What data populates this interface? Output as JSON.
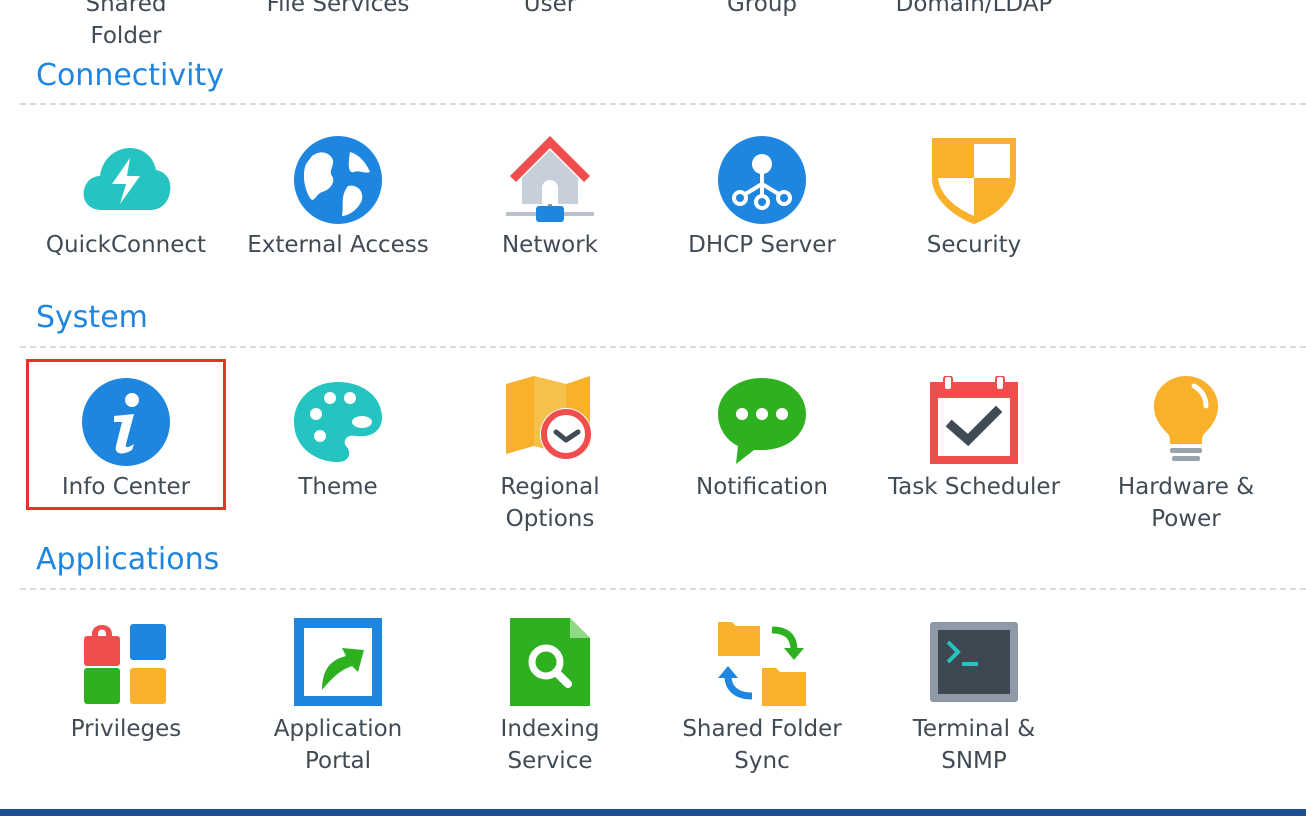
{
  "top_row": [
    {
      "name": "shared-folder",
      "label": "Shared\nFolder"
    },
    {
      "name": "file-services",
      "label": "File Services"
    },
    {
      "name": "user",
      "label": "User"
    },
    {
      "name": "group",
      "label": "Group"
    },
    {
      "name": "domain-ldap",
      "label": "Domain/LDAP"
    }
  ],
  "sections": {
    "connectivity": {
      "title": "Connectivity",
      "items": [
        {
          "label": "QuickConnect",
          "icon": "quickconnect-icon"
        },
        {
          "label": "External Access",
          "icon": "globe-icon"
        },
        {
          "label": "Network",
          "icon": "network-house-icon"
        },
        {
          "label": "DHCP Server",
          "icon": "dhcp-node-icon"
        },
        {
          "label": "Security",
          "icon": "shield-icon"
        }
      ]
    },
    "system": {
      "title": "System",
      "items": [
        {
          "label": "Info Center",
          "icon": "info-icon",
          "selected": true
        },
        {
          "label": "Theme",
          "icon": "palette-icon"
        },
        {
          "label": "Regional\nOptions",
          "icon": "map-clock-icon"
        },
        {
          "label": "Notification",
          "icon": "chat-bubble-icon"
        },
        {
          "label": "Task Scheduler",
          "icon": "calendar-check-icon"
        },
        {
          "label": "Hardware &\nPower",
          "icon": "lightbulb-icon"
        }
      ]
    },
    "applications": {
      "title": "Applications",
      "items": [
        {
          "label": "Privileges",
          "icon": "privileges-grid-icon"
        },
        {
          "label": "Application\nPortal",
          "icon": "portal-arrow-icon"
        },
        {
          "label": "Indexing\nService",
          "icon": "search-document-icon"
        },
        {
          "label": "Shared Folder\nSync",
          "icon": "folder-sync-icon"
        },
        {
          "label": "Terminal &\nSNMP",
          "icon": "terminal-icon"
        }
      ]
    }
  },
  "colors": {
    "section_title": "#1f86e0",
    "selection_border": "#e8312a",
    "footer": "#1b4f93"
  }
}
